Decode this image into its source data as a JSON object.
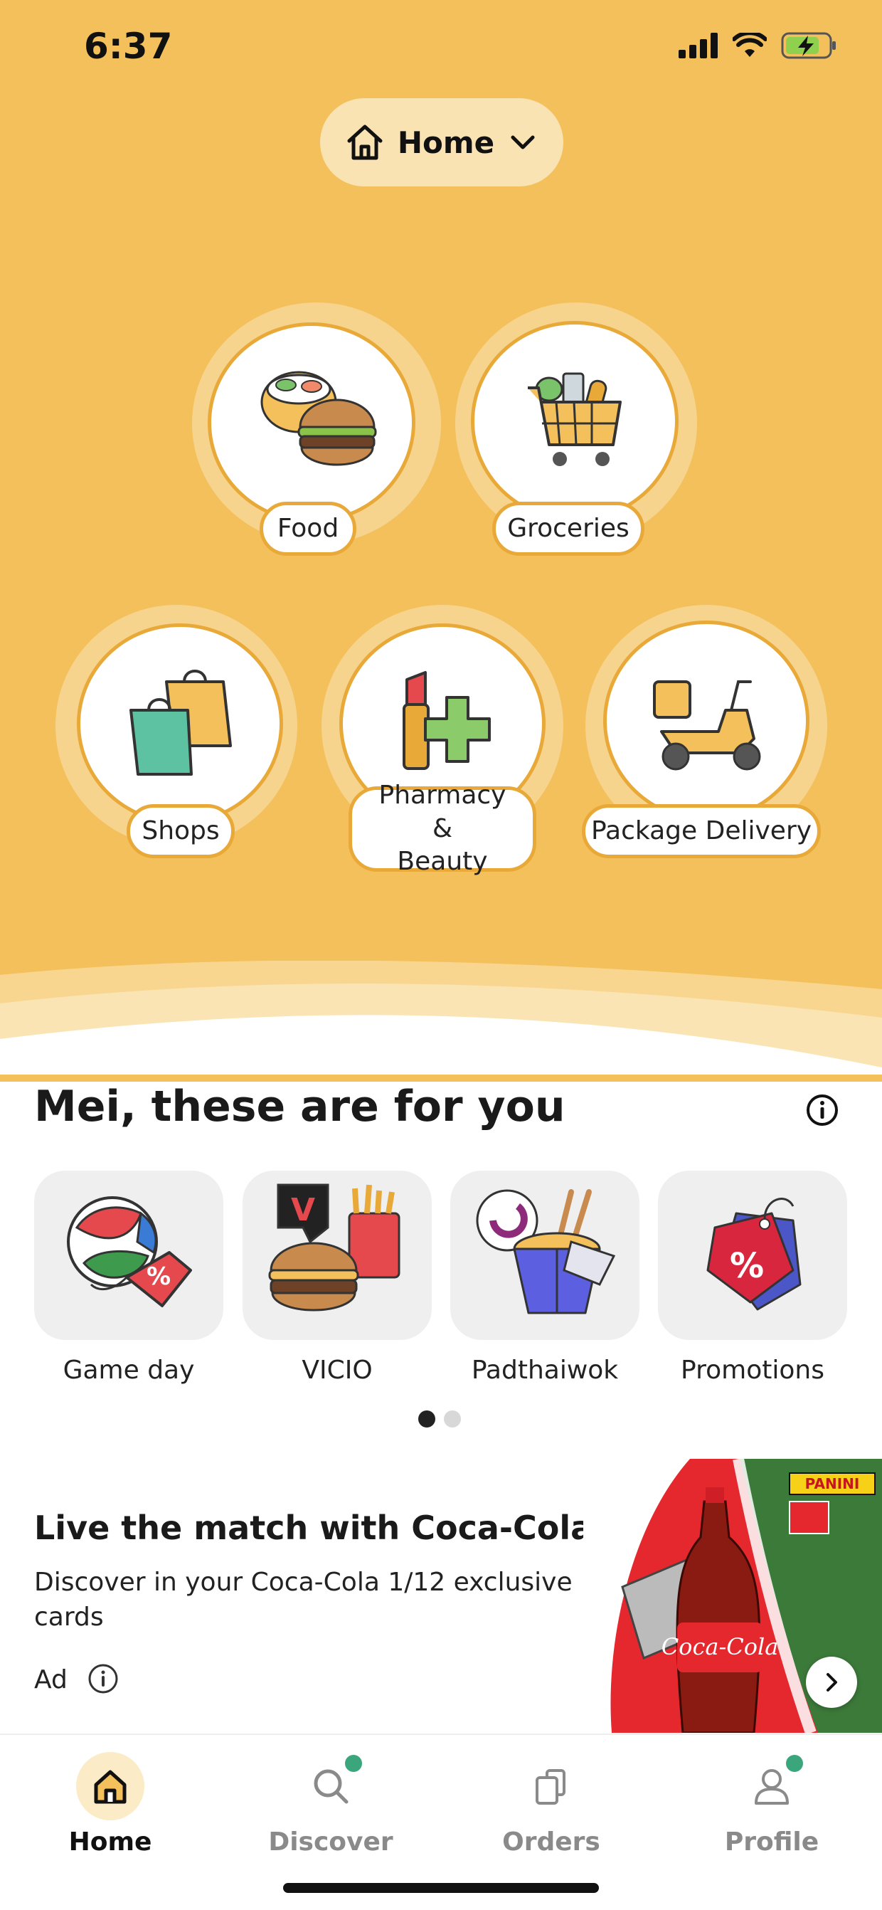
{
  "status_bar": {
    "time": "6:37"
  },
  "location": {
    "label": "Home",
    "icon": "house-icon"
  },
  "categories": [
    {
      "label": "Food",
      "icon": "food-bowl-burger-icon"
    },
    {
      "label": "Groceries",
      "icon": "shopping-cart-icon"
    },
    {
      "label": "Shops",
      "icon": "shopping-bags-icon"
    },
    {
      "label": "Pharmacy &\nBeauty",
      "icon": "lipstick-cross-icon"
    },
    {
      "label": "Package Delivery",
      "icon": "scooter-icon"
    }
  ],
  "for_you": {
    "title": "Mei, these are for you",
    "items": [
      {
        "label": "Game day",
        "icon": "ball-discount-tag-icon"
      },
      {
        "label": "VICIO",
        "icon": "burger-fries-icon"
      },
      {
        "label": "Padthaiwok",
        "icon": "noodle-box-icon"
      },
      {
        "label": "Promotions",
        "icon": "percent-tag-icon"
      }
    ],
    "page_dots": {
      "count": 2,
      "active": 0
    }
  },
  "ad": {
    "title": "Live the match with Coca-Cola",
    "description": "Discover in your Coca-Cola 1/12 exclusive cards",
    "ad_label": "Ad",
    "image_text_panini": "PANINI",
    "image_text_brand": "Coca-Cola"
  },
  "nav": [
    {
      "label": "Home",
      "icon": "home-icon",
      "active": true,
      "badge": false
    },
    {
      "label": "Discover",
      "icon": "search-icon",
      "active": false,
      "badge": true
    },
    {
      "label": "Orders",
      "icon": "orders-icon",
      "active": false,
      "badge": false
    },
    {
      "label": "Profile",
      "icon": "profile-icon",
      "active": false,
      "badge": true
    }
  ],
  "colors": {
    "brand_yellow": "#F4C05B",
    "accent_orange": "#E9A938",
    "badge_green": "#3BA57C"
  }
}
